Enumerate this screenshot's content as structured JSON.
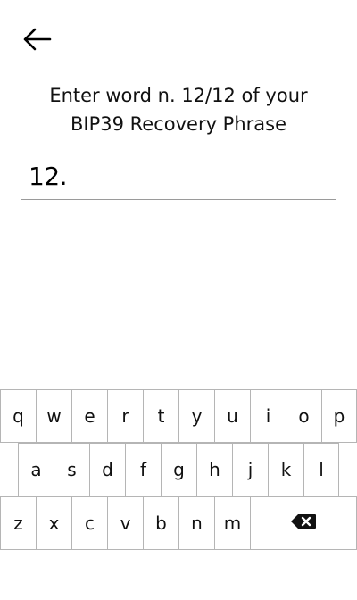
{
  "header": {
    "back_icon": "arrow-left-icon"
  },
  "prompt": {
    "line1": "Enter word n. 12/12 of your",
    "line2": "BIP39 Recovery Phrase"
  },
  "entry": {
    "index_label": "12.",
    "value": ""
  },
  "keyboard": {
    "row1": [
      "q",
      "w",
      "e",
      "r",
      "t",
      "y",
      "u",
      "i",
      "o",
      "p"
    ],
    "row2": [
      "a",
      "s",
      "d",
      "f",
      "g",
      "h",
      "j",
      "k",
      "l"
    ],
    "row3": [
      "z",
      "x",
      "c",
      "v",
      "b",
      "n",
      "m"
    ],
    "backspace_icon": "backspace-icon"
  }
}
